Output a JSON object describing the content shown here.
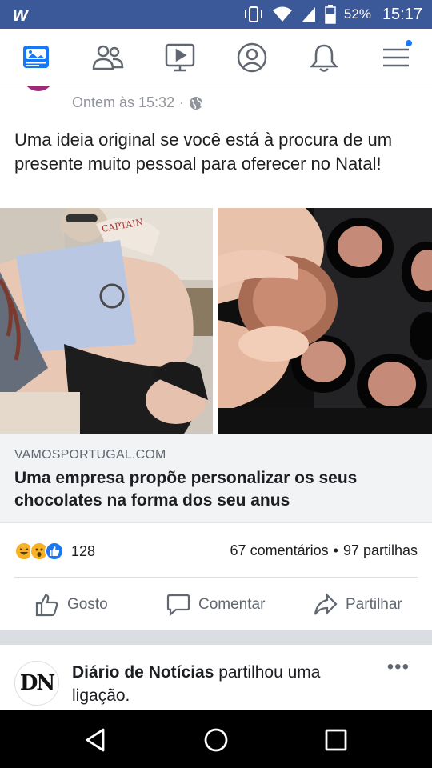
{
  "status_bar": {
    "app_icon": "w",
    "battery": "52%",
    "time": "15:17"
  },
  "nav": {
    "items": [
      "news-feed-icon",
      "friends-icon",
      "watch-icon",
      "profile-icon",
      "notifications-icon",
      "menu-icon"
    ],
    "active": "news-feed-icon",
    "accent": "#1877f2"
  },
  "post": {
    "timestamp": "Ontem às 15:32",
    "separator": "·",
    "text": "Uma ideia original se você está à procura de um presente muito pessoal para oferecer no Natal!",
    "link": {
      "domain": "VAMOSPORTUGAL.COM",
      "title": "Uma empresa propõe personalizar os seus chocolates na forma dos seu anus"
    },
    "reactions": {
      "types": [
        "haha",
        "wow",
        "like"
      ],
      "count": "128"
    },
    "engagement": {
      "comments": "67 comentários",
      "dot": "•",
      "shares": "97 partilhas"
    },
    "actions": {
      "like": "Gosto",
      "comment": "Comentar",
      "share": "Partilhar"
    }
  },
  "post2": {
    "avatar_text": "DN",
    "author": "Diário de Notícias",
    "action_text": "partilhou uma ligação.",
    "more": "•••"
  },
  "colors": {
    "status_bar": "#3b5998",
    "text_secondary": "#606770",
    "link_bg": "#f2f3f5"
  }
}
